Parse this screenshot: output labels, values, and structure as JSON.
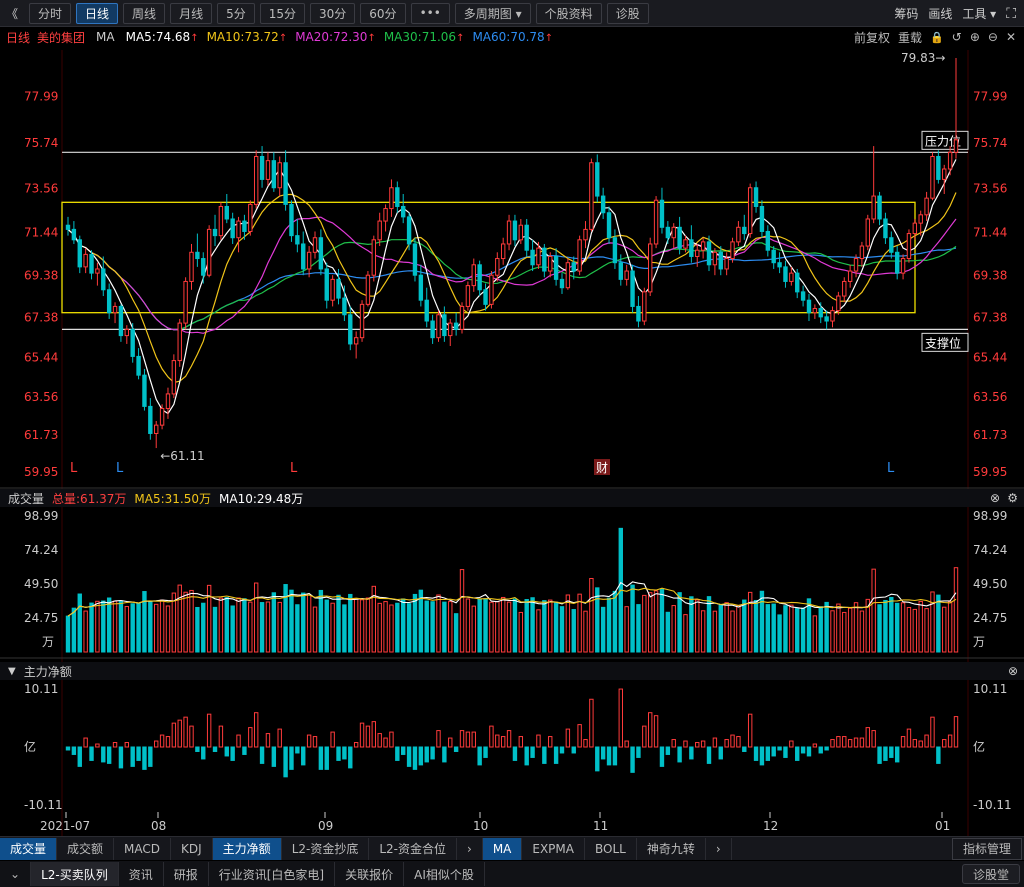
{
  "toolbar": {
    "back": "《",
    "items": [
      "分时",
      "日线",
      "周线",
      "月线",
      "5分",
      "15分",
      "30分",
      "60分",
      "•••",
      "多周期图 ▾",
      "个股资料",
      "诊股"
    ],
    "active": 1,
    "right": [
      "筹码",
      "画线",
      "工具 ▾"
    ],
    "fullscreen_glyph": "⛶"
  },
  "stock": {
    "period": "日线",
    "name": "美的集团",
    "indicator": "MA"
  },
  "ma": [
    {
      "label": "MA5:74.68",
      "color": "#ffffff"
    },
    {
      "label": "MA10:73.72",
      "color": "#f0c419"
    },
    {
      "label": "MA20:72.30",
      "color": "#e03ad6"
    },
    {
      "label": "MA30:71.06",
      "color": "#1fbf4a"
    },
    {
      "label": "MA60:70.78",
      "color": "#2d8cf0"
    }
  ],
  "up_arrow": "↑",
  "ma_right": [
    "前复权",
    "重载"
  ],
  "ma_right_icons": [
    "🔒",
    "↺",
    "⊕",
    "⊖",
    "✕"
  ],
  "price_axis": [
    "77.99",
    "75.74",
    "73.56",
    "71.44",
    "69.38",
    "67.38",
    "65.44",
    "63.56",
    "61.73",
    "59.95"
  ],
  "annotations": {
    "high": "79.83→",
    "low": "←61.11",
    "resistance": "压力位",
    "support": "支撑位",
    "fin_marker": "财",
    "l_marker": "L"
  },
  "volume": {
    "title": "成交量",
    "total": "总量:61.37万",
    "ma5": "MA5:31.50万",
    "ma10": "MA10:29.48万",
    "axis": [
      "98.99",
      "74.24",
      "49.50",
      "24.75",
      "万"
    ]
  },
  "netflow": {
    "title": "主力净额",
    "axis": [
      "10.11",
      "亿",
      "-10.11"
    ],
    "toggle": "▼"
  },
  "x_axis": [
    "2021-07",
    "08",
    "09",
    "10",
    "11",
    "12",
    "01"
  ],
  "panel_icons": {
    "close": "⊗",
    "gear": "⚙"
  },
  "tabs1": [
    "成交量",
    "成交额",
    "MACD",
    "KDJ",
    "主力净额",
    "L2-资金抄底",
    "L2-资金合位",
    "›",
    "MA",
    "EXPMA",
    "BOLL",
    "神奇九转",
    "›"
  ],
  "tabs1_active": [
    0,
    4,
    8
  ],
  "tabs1_right": "指标管理",
  "tabs2": [
    "⌄",
    "L2-买卖队列",
    "资讯",
    "研报",
    "行业资讯[白色家电]",
    "关联报价",
    "AI相似个股"
  ],
  "tabs2_right": "诊股堂",
  "colors": {
    "up": "#ff3b3b",
    "down": "#00c0c8",
    "bg": "#000000",
    "frame": "#f0e000"
  },
  "chart_data": {
    "type": "candlestick",
    "title": "美的集团 日线",
    "ylim": [
      59.95,
      79.83
    ],
    "x_labels": [
      "2021-07",
      "08",
      "09",
      "10",
      "11",
      "12",
      "01"
    ],
    "note": "Daily OHLC estimated from screenshot; volume in 万手, net flow in 亿",
    "ohlc": [
      [
        71.8,
        72.2,
        71.3,
        71.6
      ],
      [
        71.6,
        72.0,
        70.9,
        71.1
      ],
      [
        71.1,
        71.3,
        69.5,
        69.8
      ],
      [
        69.8,
        70.7,
        69.5,
        70.4
      ],
      [
        70.4,
        70.6,
        69.2,
        69.5
      ],
      [
        69.5,
        70.0,
        68.9,
        69.7
      ],
      [
        69.7,
        70.3,
        68.4,
        68.7
      ],
      [
        68.7,
        69.0,
        67.3,
        67.6
      ],
      [
        67.6,
        68.1,
        67.1,
        67.9
      ],
      [
        67.9,
        68.0,
        66.2,
        66.5
      ],
      [
        66.5,
        67.0,
        66.1,
        66.8
      ],
      [
        66.8,
        67.1,
        65.2,
        65.5
      ],
      [
        65.5,
        65.9,
        64.4,
        64.6
      ],
      [
        64.6,
        64.9,
        62.9,
        63.1
      ],
      [
        63.1,
        63.5,
        61.5,
        61.8
      ],
      [
        61.8,
        62.4,
        61.1,
        62.2
      ],
      [
        62.2,
        63.2,
        62.0,
        63.0
      ],
      [
        63.0,
        64.0,
        62.5,
        63.7
      ],
      [
        63.7,
        65.6,
        63.5,
        65.3
      ],
      [
        65.3,
        67.3,
        65.0,
        67.1
      ],
      [
        67.1,
        69.3,
        66.8,
        69.1
      ],
      [
        69.1,
        70.9,
        68.7,
        70.5
      ],
      [
        70.5,
        71.4,
        69.8,
        70.2
      ],
      [
        70.2,
        70.5,
        69.0,
        69.4
      ],
      [
        69.4,
        71.8,
        69.3,
        71.6
      ],
      [
        71.6,
        72.3,
        70.8,
        71.3
      ],
      [
        71.3,
        72.9,
        71.1,
        72.7
      ],
      [
        72.7,
        73.3,
        71.9,
        72.1
      ],
      [
        72.1,
        72.4,
        70.9,
        71.2
      ],
      [
        71.2,
        72.2,
        70.5,
        72.0
      ],
      [
        72.0,
        72.3,
        71.1,
        71.5
      ],
      [
        71.5,
        73.0,
        71.3,
        72.8
      ],
      [
        72.8,
        75.4,
        72.6,
        75.1
      ],
      [
        75.1,
        75.6,
        73.6,
        74.0
      ],
      [
        74.0,
        75.3,
        73.7,
        74.9
      ],
      [
        74.9,
        75.3,
        73.4,
        73.6
      ],
      [
        73.6,
        75.1,
        73.2,
        74.8
      ],
      [
        74.8,
        75.4,
        72.5,
        72.8
      ],
      [
        72.8,
        73.0,
        71.0,
        71.3
      ],
      [
        71.3,
        72.1,
        70.5,
        70.9
      ],
      [
        70.9,
        71.5,
        69.4,
        69.7
      ],
      [
        69.7,
        70.8,
        69.3,
        70.5
      ],
      [
        70.5,
        71.5,
        70.2,
        71.2
      ],
      [
        71.2,
        71.6,
        69.4,
        69.7
      ],
      [
        69.7,
        70.0,
        67.8,
        68.2
      ],
      [
        68.2,
        69.4,
        67.9,
        69.2
      ],
      [
        69.2,
        69.7,
        68.0,
        68.3
      ],
      [
        68.3,
        68.9,
        67.2,
        67.5
      ],
      [
        67.5,
        67.9,
        65.8,
        66.1
      ],
      [
        66.1,
        66.7,
        65.4,
        66.4
      ],
      [
        66.4,
        68.2,
        66.2,
        68.0
      ],
      [
        68.0,
        69.6,
        67.9,
        69.4
      ],
      [
        69.4,
        71.3,
        69.1,
        71.1
      ],
      [
        71.1,
        72.4,
        70.8,
        72.0
      ],
      [
        72.0,
        72.8,
        71.5,
        72.6
      ],
      [
        72.6,
        74.0,
        72.2,
        73.6
      ],
      [
        73.6,
        73.9,
        72.4,
        72.7
      ],
      [
        72.7,
        73.3,
        71.9,
        72.2
      ],
      [
        72.2,
        72.4,
        70.6,
        70.9
      ],
      [
        70.9,
        71.2,
        69.1,
        69.4
      ],
      [
        69.4,
        69.9,
        67.9,
        68.2
      ],
      [
        68.2,
        68.8,
        66.9,
        67.2
      ],
      [
        67.2,
        67.5,
        66.1,
        66.4
      ],
      [
        66.4,
        67.7,
        66.2,
        67.5
      ],
      [
        67.5,
        67.9,
        66.2,
        66.5
      ],
      [
        66.5,
        67.3,
        66.0,
        67.1
      ],
      [
        67.1,
        67.6,
        66.5,
        66.8
      ],
      [
        66.8,
        68.1,
        66.6,
        67.9
      ],
      [
        67.9,
        69.1,
        67.7,
        68.9
      ],
      [
        68.9,
        70.2,
        68.6,
        69.9
      ],
      [
        69.9,
        70.1,
        68.4,
        68.7
      ],
      [
        68.7,
        69.0,
        67.7,
        68.0
      ],
      [
        68.0,
        69.6,
        67.8,
        69.4
      ],
      [
        69.4,
        70.5,
        69.1,
        70.2
      ],
      [
        70.2,
        71.2,
        69.9,
        70.9
      ],
      [
        70.9,
        72.3,
        70.6,
        72.0
      ],
      [
        72.0,
        72.3,
        70.8,
        71.1
      ],
      [
        71.1,
        72.1,
        70.9,
        71.8
      ],
      [
        71.8,
        72.1,
        70.3,
        70.6
      ],
      [
        70.6,
        71.1,
        69.6,
        69.9
      ],
      [
        69.9,
        71.0,
        69.7,
        70.7
      ],
      [
        70.7,
        70.9,
        69.3,
        69.6
      ],
      [
        69.6,
        70.5,
        69.3,
        70.3
      ],
      [
        70.3,
        70.7,
        68.9,
        69.2
      ],
      [
        69.2,
        69.5,
        68.5,
        68.8
      ],
      [
        68.8,
        70.2,
        68.7,
        70.0
      ],
      [
        70.0,
        70.3,
        69.2,
        69.6
      ],
      [
        69.6,
        71.3,
        69.4,
        71.1
      ],
      [
        71.1,
        72.0,
        70.7,
        71.6
      ],
      [
        71.6,
        75.0,
        71.5,
        74.8
      ],
      [
        74.8,
        75.2,
        72.9,
        73.2
      ],
      [
        73.2,
        73.6,
        72.1,
        72.4
      ],
      [
        72.4,
        72.7,
        70.9,
        71.2
      ],
      [
        71.2,
        71.6,
        69.7,
        70.0
      ],
      [
        70.0,
        70.4,
        68.9,
        69.2
      ],
      [
        69.2,
        69.9,
        68.9,
        69.6
      ],
      [
        69.6,
        69.9,
        67.6,
        67.9
      ],
      [
        67.9,
        68.4,
        66.9,
        67.2
      ],
      [
        67.2,
        68.8,
        67.0,
        68.6
      ],
      [
        68.6,
        71.2,
        68.4,
        70.9
      ],
      [
        70.9,
        73.2,
        70.7,
        73.0
      ],
      [
        73.0,
        73.6,
        71.4,
        71.7
      ],
      [
        71.7,
        72.0,
        70.9,
        71.2
      ],
      [
        71.2,
        71.9,
        70.7,
        71.7
      ],
      [
        71.7,
        72.2,
        70.4,
        70.7
      ],
      [
        70.7,
        71.3,
        70.5,
        71.1
      ],
      [
        71.1,
        71.8,
        70.0,
        70.3
      ],
      [
        70.3,
        70.9,
        69.8,
        70.6
      ],
      [
        70.6,
        71.2,
        70.2,
        71.0
      ],
      [
        71.0,
        71.3,
        69.6,
        69.9
      ],
      [
        69.9,
        70.7,
        69.4,
        70.5
      ],
      [
        70.5,
        70.8,
        69.4,
        69.7
      ],
      [
        69.7,
        70.5,
        69.4,
        70.2
      ],
      [
        70.2,
        71.2,
        70.0,
        71.0
      ],
      [
        71.0,
        72.0,
        70.8,
        71.7
      ],
      [
        71.7,
        72.3,
        71.1,
        71.4
      ],
      [
        71.4,
        73.8,
        71.2,
        73.6
      ],
      [
        73.6,
        73.9,
        72.4,
        72.7
      ],
      [
        72.7,
        73.0,
        71.2,
        71.5
      ],
      [
        71.5,
        71.8,
        70.3,
        70.6
      ],
      [
        70.6,
        70.8,
        69.7,
        70.0
      ],
      [
        70.0,
        70.5,
        69.5,
        69.8
      ],
      [
        69.8,
        70.1,
        68.8,
        69.1
      ],
      [
        69.1,
        69.8,
        68.9,
        69.5
      ],
      [
        69.5,
        69.7,
        68.3,
        68.6
      ],
      [
        68.6,
        68.9,
        67.9,
        68.2
      ],
      [
        68.2,
        68.5,
        67.2,
        67.6
      ],
      [
        67.6,
        68.0,
        67.3,
        67.8
      ],
      [
        67.8,
        68.1,
        67.1,
        67.4
      ],
      [
        67.4,
        67.7,
        66.8,
        67.2
      ],
      [
        67.2,
        67.9,
        66.9,
        67.7
      ],
      [
        67.7,
        68.6,
        67.5,
        68.4
      ],
      [
        68.4,
        69.3,
        68.1,
        69.1
      ],
      [
        69.1,
        69.9,
        68.8,
        69.6
      ],
      [
        69.6,
        70.4,
        69.3,
        70.2
      ],
      [
        70.2,
        71.0,
        69.8,
        70.8
      ],
      [
        70.8,
        72.3,
        70.6,
        72.1
      ],
      [
        72.1,
        75.6,
        71.9,
        73.2
      ],
      [
        73.2,
        73.4,
        71.8,
        72.1
      ],
      [
        72.1,
        72.4,
        70.9,
        71.2
      ],
      [
        71.2,
        71.5,
        70.2,
        70.5
      ],
      [
        70.5,
        70.8,
        69.2,
        69.5
      ],
      [
        69.5,
        70.4,
        69.2,
        70.2
      ],
      [
        70.2,
        71.6,
        70.0,
        71.4
      ],
      [
        71.4,
        72.1,
        71.1,
        71.9
      ],
      [
        71.9,
        72.5,
        71.3,
        72.3
      ],
      [
        72.3,
        73.4,
        72.0,
        73.1
      ],
      [
        73.1,
        75.3,
        73.0,
        75.1
      ],
      [
        75.1,
        75.4,
        73.8,
        74.0
      ],
      [
        74.0,
        74.7,
        73.3,
        74.5
      ],
      [
        74.5,
        75.6,
        74.2,
        75.3
      ],
      [
        75.3,
        79.83,
        75.0,
        75.9
      ]
    ],
    "ma5_last": 74.68,
    "ma10_last": 73.72,
    "ma20_last": 72.3,
    "ma30_last": 71.06,
    "ma60_last": 70.78,
    "resistance": 75.3,
    "support": 66.8,
    "box_high": 72.9,
    "box_low": 67.6
  }
}
